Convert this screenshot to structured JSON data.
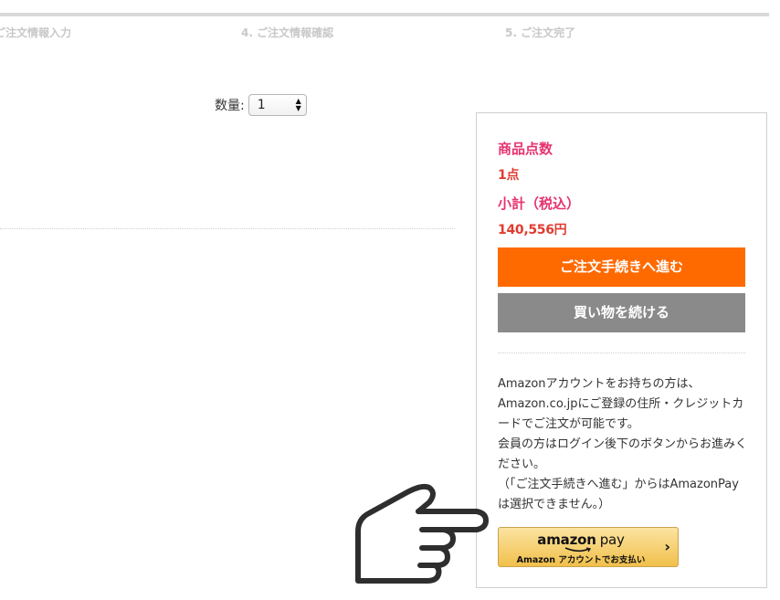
{
  "steps": {
    "step3": "ご注文情報入力",
    "step4": "4. ご注文情報確認",
    "step5": "5. ご注文完了"
  },
  "quantity": {
    "label": "数量:",
    "value": "1"
  },
  "summary": {
    "count_label": "商品点数",
    "count_value": "1点",
    "subtotal_label": "小計（税込）",
    "subtotal_value": "140,556円",
    "checkout_button": "ご注文手続きへ進む",
    "continue_button": "買い物を続ける"
  },
  "amazon_note": {
    "line1": "Amazonアカウントをお持ちの方は、Amazon.co.jpにご登録の住所・クレジットカードでご注文が可能です。",
    "line2": "会員の方はログイン後下のボタンからお進みください。",
    "line3": "（「ご注文手続きへ進む」からはAmazonPayは選択できません。）"
  },
  "amazon_pay": {
    "brand": "amazon",
    "pay": "pay",
    "subtitle": "Amazon アカウントでお支払い"
  },
  "colors": {
    "accent_pink": "#e6336f",
    "value_red": "#e23b2f",
    "checkout_orange": "#ff6a00",
    "continue_gray": "#8a8a8a"
  },
  "icons": {
    "pointer": "hand-pointing-right-icon",
    "chevron": "chevron-right-icon"
  }
}
